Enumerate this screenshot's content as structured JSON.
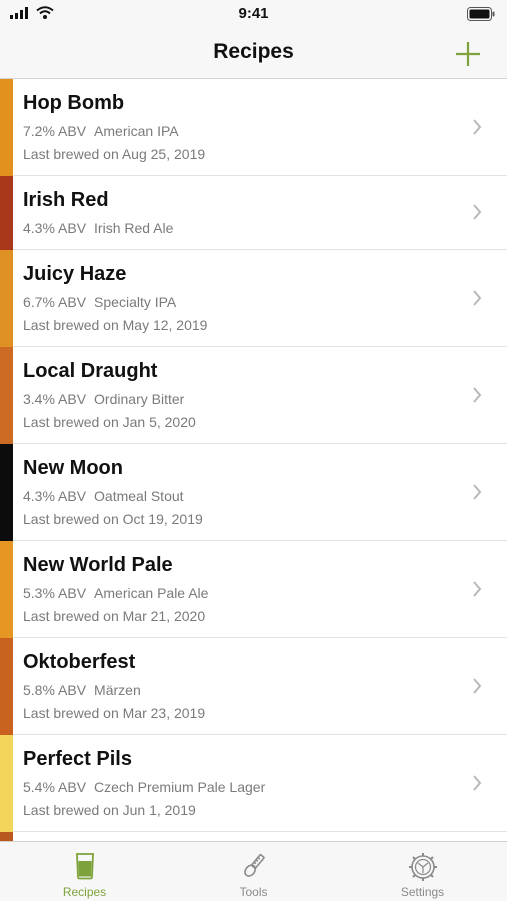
{
  "status": {
    "time": "9:41"
  },
  "nav": {
    "title": "Recipes",
    "add_icon": "plus-icon",
    "accent": "#7ea23b"
  },
  "recipes": [
    {
      "name": "Hop Bomb",
      "abv": "7.2% ABV",
      "style": "American IPA",
      "last": "Last brewed on Aug 25, 2019",
      "color": "#e2901e"
    },
    {
      "name": "Irish Red",
      "abv": "4.3% ABV",
      "style": "Irish Red Ale",
      "last": "",
      "color": "#a9381b"
    },
    {
      "name": "Juicy Haze",
      "abv": "6.7% ABV",
      "style": "Specialty IPA",
      "last": "Last brewed on May 12, 2019",
      "color": "#e09124"
    },
    {
      "name": "Local Draught",
      "abv": "3.4% ABV",
      "style": "Ordinary Bitter",
      "last": "Last brewed on Jan 5, 2020",
      "color": "#cd6a24"
    },
    {
      "name": "New Moon",
      "abv": "4.3% ABV",
      "style": "Oatmeal Stout",
      "last": "Last brewed on Oct 19, 2019",
      "color": "#0c0c0c"
    },
    {
      "name": "New World Pale",
      "abv": "5.3% ABV",
      "style": "American Pale Ale",
      "last": "Last brewed on Mar 21, 2020",
      "color": "#e69622"
    },
    {
      "name": "Oktoberfest",
      "abv": "5.8% ABV",
      "style": "Märzen",
      "last": "Last brewed on Mar 23, 2019",
      "color": "#c9611f"
    },
    {
      "name": "Perfect Pils",
      "abv": "5.4% ABV",
      "style": "Czech Premium Pale Lager",
      "last": "Last brewed on Jun 1, 2019",
      "color": "#f4d55c"
    }
  ],
  "tabs": [
    {
      "label": "Recipes",
      "icon": "beer-glass-icon",
      "active": true
    },
    {
      "label": "Tools",
      "icon": "hydrometer-icon",
      "active": false
    },
    {
      "label": "Settings",
      "icon": "settings-gear-icon",
      "active": false
    }
  ]
}
